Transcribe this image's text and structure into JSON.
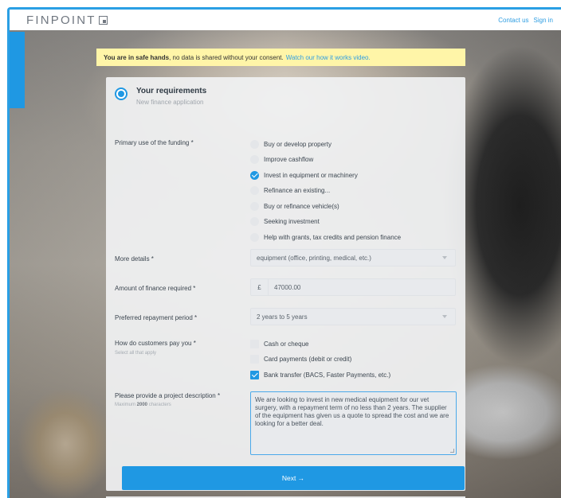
{
  "header": {
    "logo_text": "FINPOINT",
    "contact_label": "Contact us",
    "signin_label": "Sign in"
  },
  "banner": {
    "bold_text": "You are in safe hands",
    "text": ", no data is shared without your consent.",
    "link_text": "Watch our how it works video."
  },
  "step": {
    "title": "Your requirements",
    "subtitle": "New finance application"
  },
  "funding": {
    "label": "Primary use of the funding *",
    "options": [
      {
        "label": "Buy or develop property",
        "selected": false
      },
      {
        "label": "Improve cashflow",
        "selected": false
      },
      {
        "label": "Invest in equipment or machinery",
        "selected": true
      },
      {
        "label": "Refinance an existing...",
        "selected": false
      },
      {
        "label": "Buy or refinance vehicle(s)",
        "selected": false
      },
      {
        "label": "Seeking investment",
        "selected": false
      },
      {
        "label": "Help with grants, tax credits and pension finance",
        "selected": false
      }
    ]
  },
  "details": {
    "label": "More details *",
    "value": "equipment (office, printing, medical, etc.)"
  },
  "amount": {
    "label": "Amount of finance required *",
    "currency": "£",
    "value": "47000.00"
  },
  "period": {
    "label": "Preferred repayment period *",
    "value": "2 years to 5 years"
  },
  "payments": {
    "label": "How do customers pay you *",
    "hint": "Select all that apply",
    "options": [
      {
        "label": "Cash or cheque",
        "checked": false
      },
      {
        "label": "Card payments (debit or credit)",
        "checked": false
      },
      {
        "label": "Bank transfer (BACS, Faster Payments, etc.)",
        "checked": true
      }
    ]
  },
  "description": {
    "label": "Please provide a project description *",
    "hint_prefix": "Maximum ",
    "hint_number": "2000",
    "hint_suffix": " characters",
    "value": "We are looking to invest in new medical equipment for our vet surgery, with a repayment term of no less than 2 years. The supplier of the equipment has given us a quote to spread the cost and we are looking for a better deal."
  },
  "next_button": {
    "label": "Next →"
  }
}
